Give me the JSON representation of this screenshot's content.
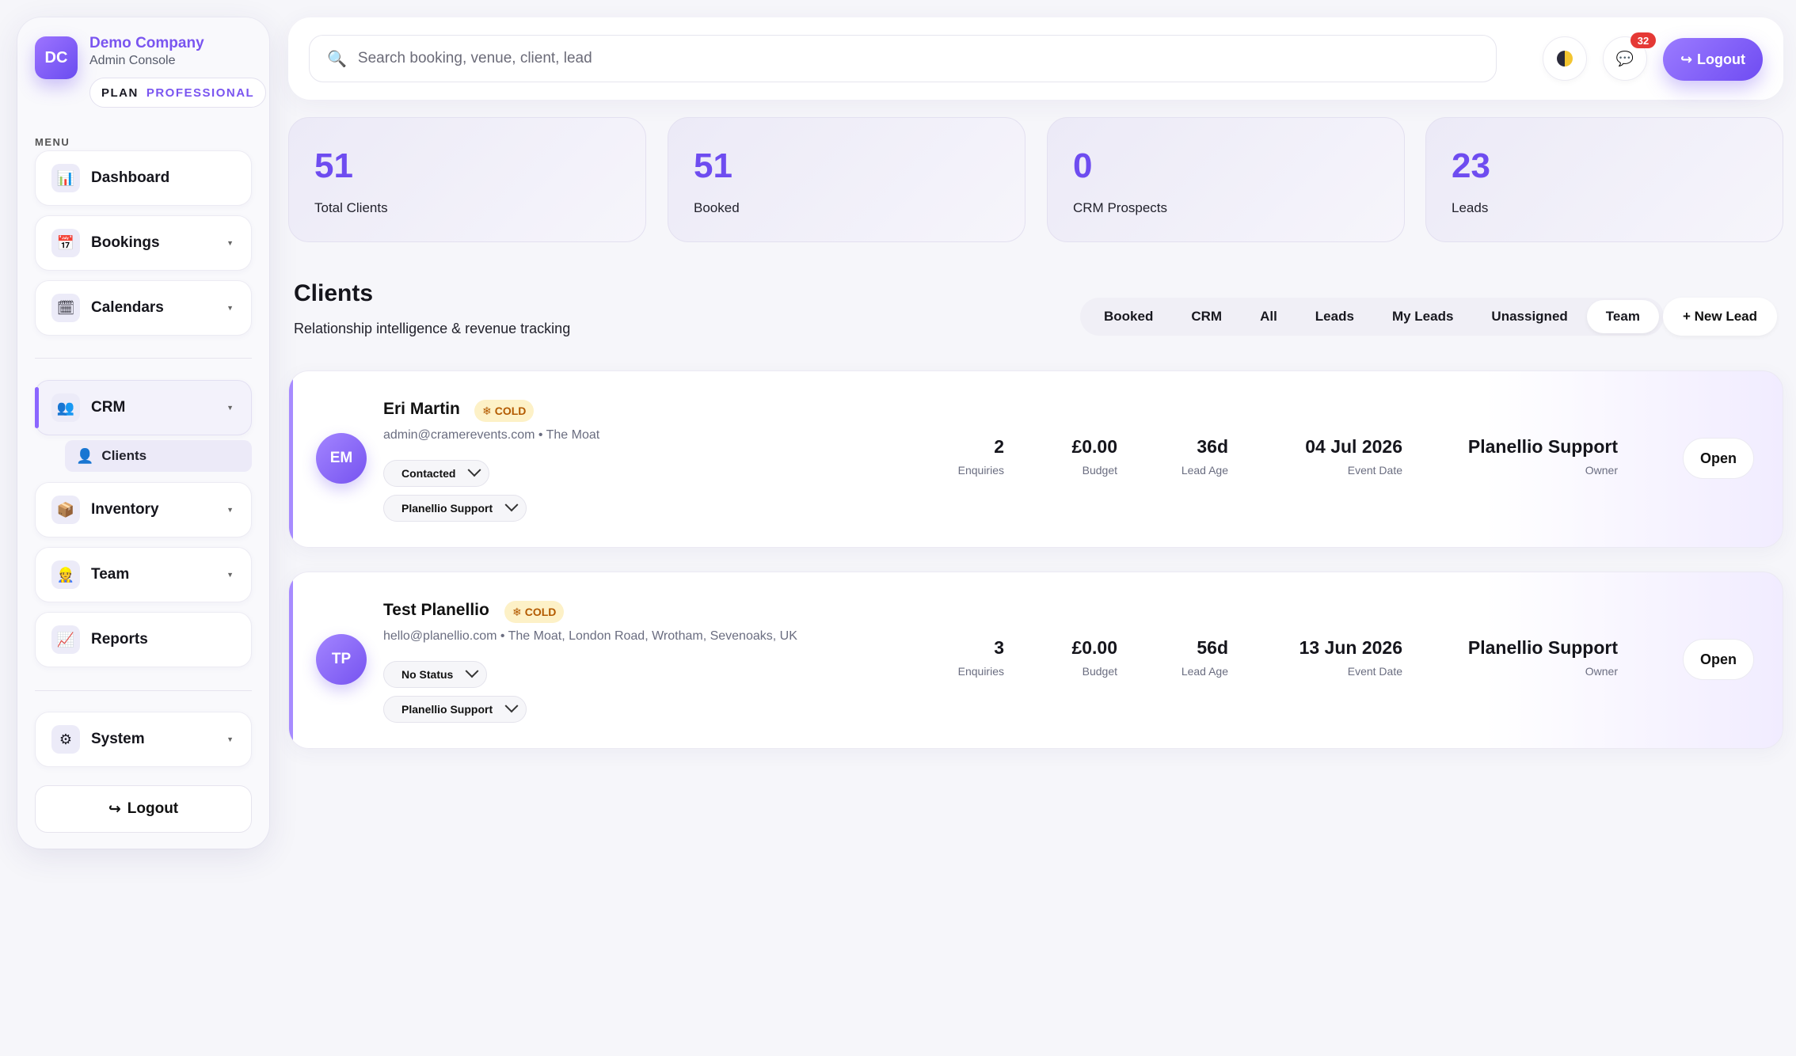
{
  "brand": {
    "initials": "DC",
    "name": "Demo Company",
    "subtitle": "Admin Console",
    "plan_key": "PLAN",
    "plan_value": "PROFESSIONAL"
  },
  "menu_label": "MENU",
  "nav": [
    {
      "label": "Dashboard",
      "icon": "📊"
    },
    {
      "label": "Bookings",
      "icon": "📅"
    },
    {
      "label": "Calendars",
      "icon": "🗓"
    },
    {
      "label": "CRM",
      "icon": "👥"
    },
    {
      "label": "Clients",
      "icon": "👤"
    },
    {
      "label": "Inventory",
      "icon": "📦"
    },
    {
      "label": "Team",
      "icon": "👷"
    },
    {
      "label": "Reports",
      "icon": "📈"
    },
    {
      "label": "System",
      "icon": "⚙"
    }
  ],
  "sidebar_logout": "Logout",
  "topbar": {
    "search_placeholder": "Search booking, venue, client, lead",
    "messages_count": "32",
    "logout_label": "Logout"
  },
  "stats": [
    {
      "value": "51",
      "label": "Total Clients"
    },
    {
      "value": "51",
      "label": "Booked"
    },
    {
      "value": "0",
      "label": "CRM Prospects"
    },
    {
      "value": "23",
      "label": "Leads"
    }
  ],
  "section": {
    "title": "Clients",
    "subtitle": "Relationship intelligence & revenue tracking",
    "filters": [
      "Booked",
      "CRM",
      "All",
      "Leads",
      "My Leads",
      "Unassigned",
      "Team"
    ],
    "selected_filter": "Team",
    "new_lead": "+ New Lead"
  },
  "clients": [
    {
      "initials": "EM",
      "name": "Eri Martin",
      "tag": "COLD",
      "meta": "admin@cramerevents.com • The Moat",
      "status": "Contacted",
      "owner_select": "Planellio Support",
      "enquiries": "2",
      "enquiries_label": "Enquiries",
      "budget": "£0.00",
      "budget_label": "Budget",
      "lead_age": "36d",
      "lead_age_label": "Lead Age",
      "event_date": "04 Jul 2026",
      "event_date_label": "Event Date",
      "owner": "Planellio Support",
      "owner_label": "Owner",
      "open": "Open"
    },
    {
      "initials": "TP",
      "name": "Test Planellio",
      "tag": "COLD",
      "meta": "hello@planellio.com • The Moat, London Road, Wrotham, Sevenoaks, UK",
      "status": "No Status",
      "owner_select": "Planellio Support",
      "enquiries": "3",
      "enquiries_label": "Enquiries",
      "budget": "£0.00",
      "budget_label": "Budget",
      "lead_age": "56d",
      "lead_age_label": "Lead Age",
      "event_date": "13 Jun 2026",
      "event_date_label": "Event Date",
      "owner": "Planellio Support",
      "owner_label": "Owner",
      "open": "Open"
    }
  ]
}
